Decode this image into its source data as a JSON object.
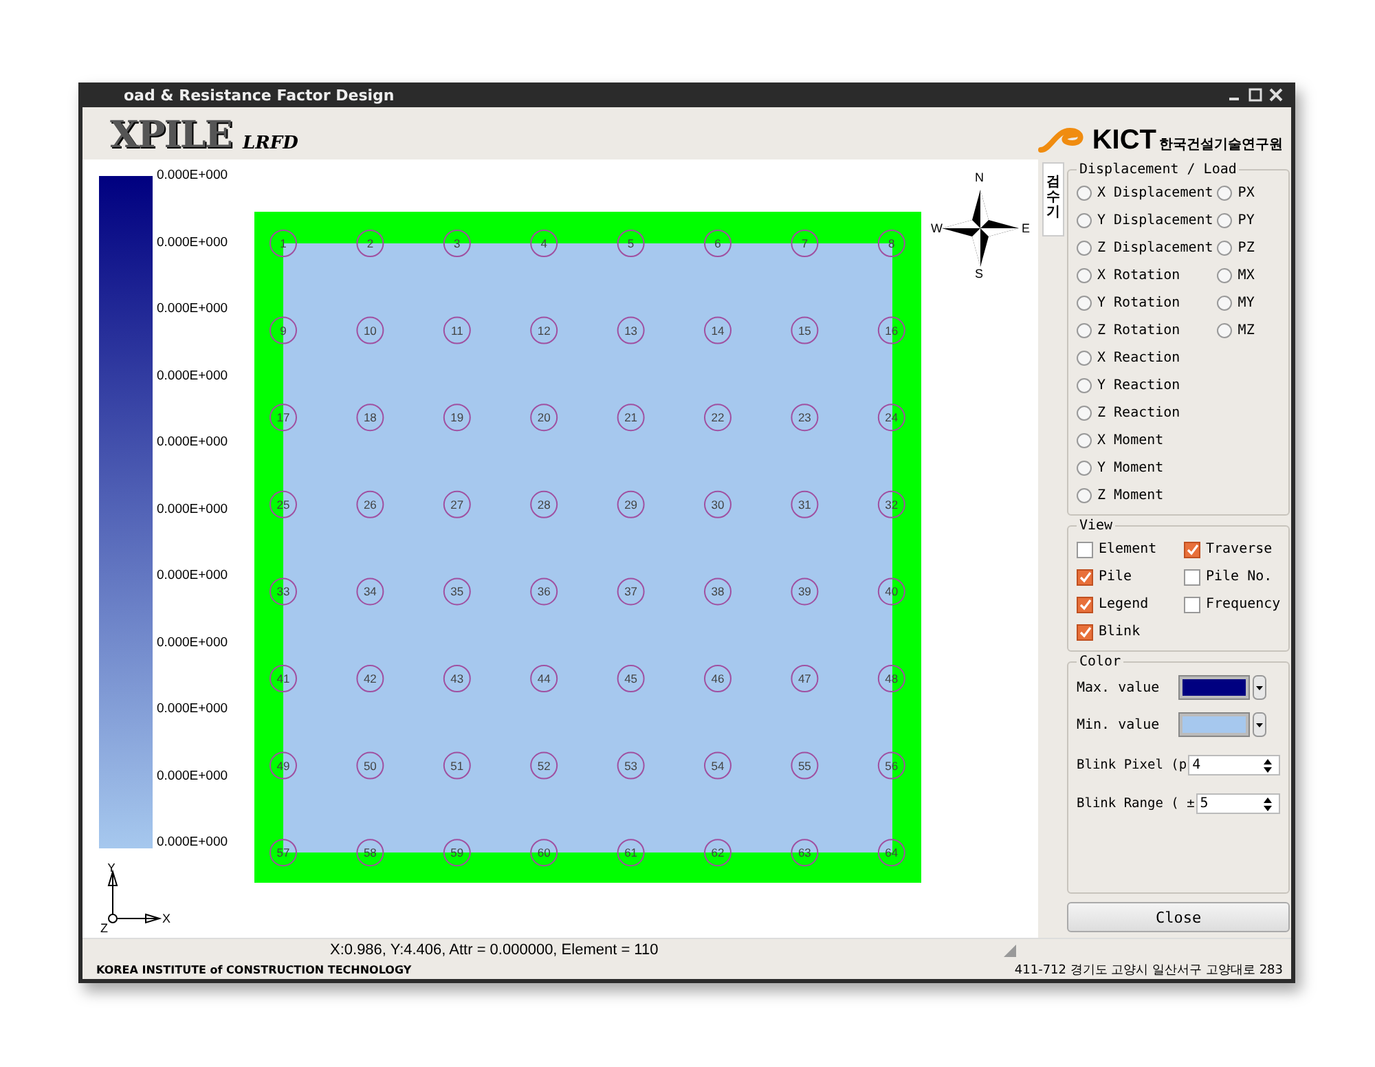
{
  "window": {
    "title": "oad & Resistance Factor Design",
    "logo": "XPILE",
    "logo_sub": "LRFD",
    "org_logo": "KICT",
    "org_name": "한국건설기술연구원"
  },
  "legend": {
    "labels": [
      "0.000E+000",
      "0.000E+000",
      "0.000E+000",
      "0.000E+000",
      "0.000E+000",
      "0.000E+000",
      "0.000E+000",
      "0.000E+000",
      "0.000E+000",
      "0.000E+000",
      "0.000E+000"
    ]
  },
  "axes": {
    "y": "Y",
    "x": "X",
    "z": "Z"
  },
  "compass": {
    "n": "N",
    "s": "S",
    "e": "E",
    "w": "W"
  },
  "piles": [
    "1",
    "2",
    "3",
    "4",
    "5",
    "6",
    "7",
    "8",
    "9",
    "10",
    "11",
    "12",
    "13",
    "14",
    "15",
    "16",
    "17",
    "18",
    "19",
    "20",
    "21",
    "22",
    "23",
    "24",
    "25",
    "26",
    "27",
    "28",
    "29",
    "30",
    "31",
    "32",
    "33",
    "34",
    "35",
    "36",
    "37",
    "38",
    "39",
    "40",
    "41",
    "42",
    "43",
    "44",
    "45",
    "46",
    "47",
    "48",
    "49",
    "50",
    "51",
    "52",
    "53",
    "54",
    "55",
    "56",
    "57",
    "58",
    "59",
    "60",
    "61",
    "62",
    "63",
    "64"
  ],
  "side_tab": "검수기",
  "displacement_load": {
    "title": "Displacement / Load",
    "left": [
      {
        "label": "X Displacement",
        "selected": false
      },
      {
        "label": "Y Displacement",
        "selected": false
      },
      {
        "label": "Z Displacement",
        "selected": false
      },
      {
        "label": "X Rotation",
        "selected": false
      },
      {
        "label": "Y Rotation",
        "selected": false
      },
      {
        "label": "Z Rotation",
        "selected": false
      },
      {
        "label": "X Reaction",
        "selected": false
      },
      {
        "label": "Y Reaction",
        "selected": false
      },
      {
        "label": "Z Reaction",
        "selected": false
      },
      {
        "label": "X Moment",
        "selected": false
      },
      {
        "label": "Y Moment",
        "selected": false
      },
      {
        "label": "Z Moment",
        "selected": false
      }
    ],
    "right": [
      {
        "label": "PX",
        "selected": false
      },
      {
        "label": "PY",
        "selected": false
      },
      {
        "label": "PZ",
        "selected": false
      },
      {
        "label": "MX",
        "selected": false
      },
      {
        "label": "MY",
        "selected": false
      },
      {
        "label": "MZ",
        "selected": false
      }
    ]
  },
  "view": {
    "title": "View",
    "options": [
      {
        "label": "Element",
        "checked": false
      },
      {
        "label": "Traverse",
        "checked": true
      },
      {
        "label": "Pile",
        "checked": true
      },
      {
        "label": "Pile No.",
        "checked": false
      },
      {
        "label": "Legend",
        "checked": true
      },
      {
        "label": "Frequency",
        "checked": false
      },
      {
        "label": "Blink",
        "checked": true
      }
    ]
  },
  "color": {
    "title": "Color",
    "swatches": [
      {
        "label": "Max. value",
        "color": "#000080"
      },
      {
        "label": "Min. value",
        "color": "#a6c8ee"
      }
    ],
    "spinners": [
      {
        "label": "Blink Pixel (p",
        "value": "4"
      },
      {
        "label": "Blink Range ( ±",
        "value": "5"
      }
    ]
  },
  "close_button": "Close",
  "status_bar": "X:0.986, Y:4.406, Attr = 0.000000, Element = 110",
  "footer": {
    "left": "KOREA INSTITUTE of CONSTRUCTION TECHNOLOGY",
    "right": "411-712 경기도 고양시 일산서구 고양대로 283"
  }
}
